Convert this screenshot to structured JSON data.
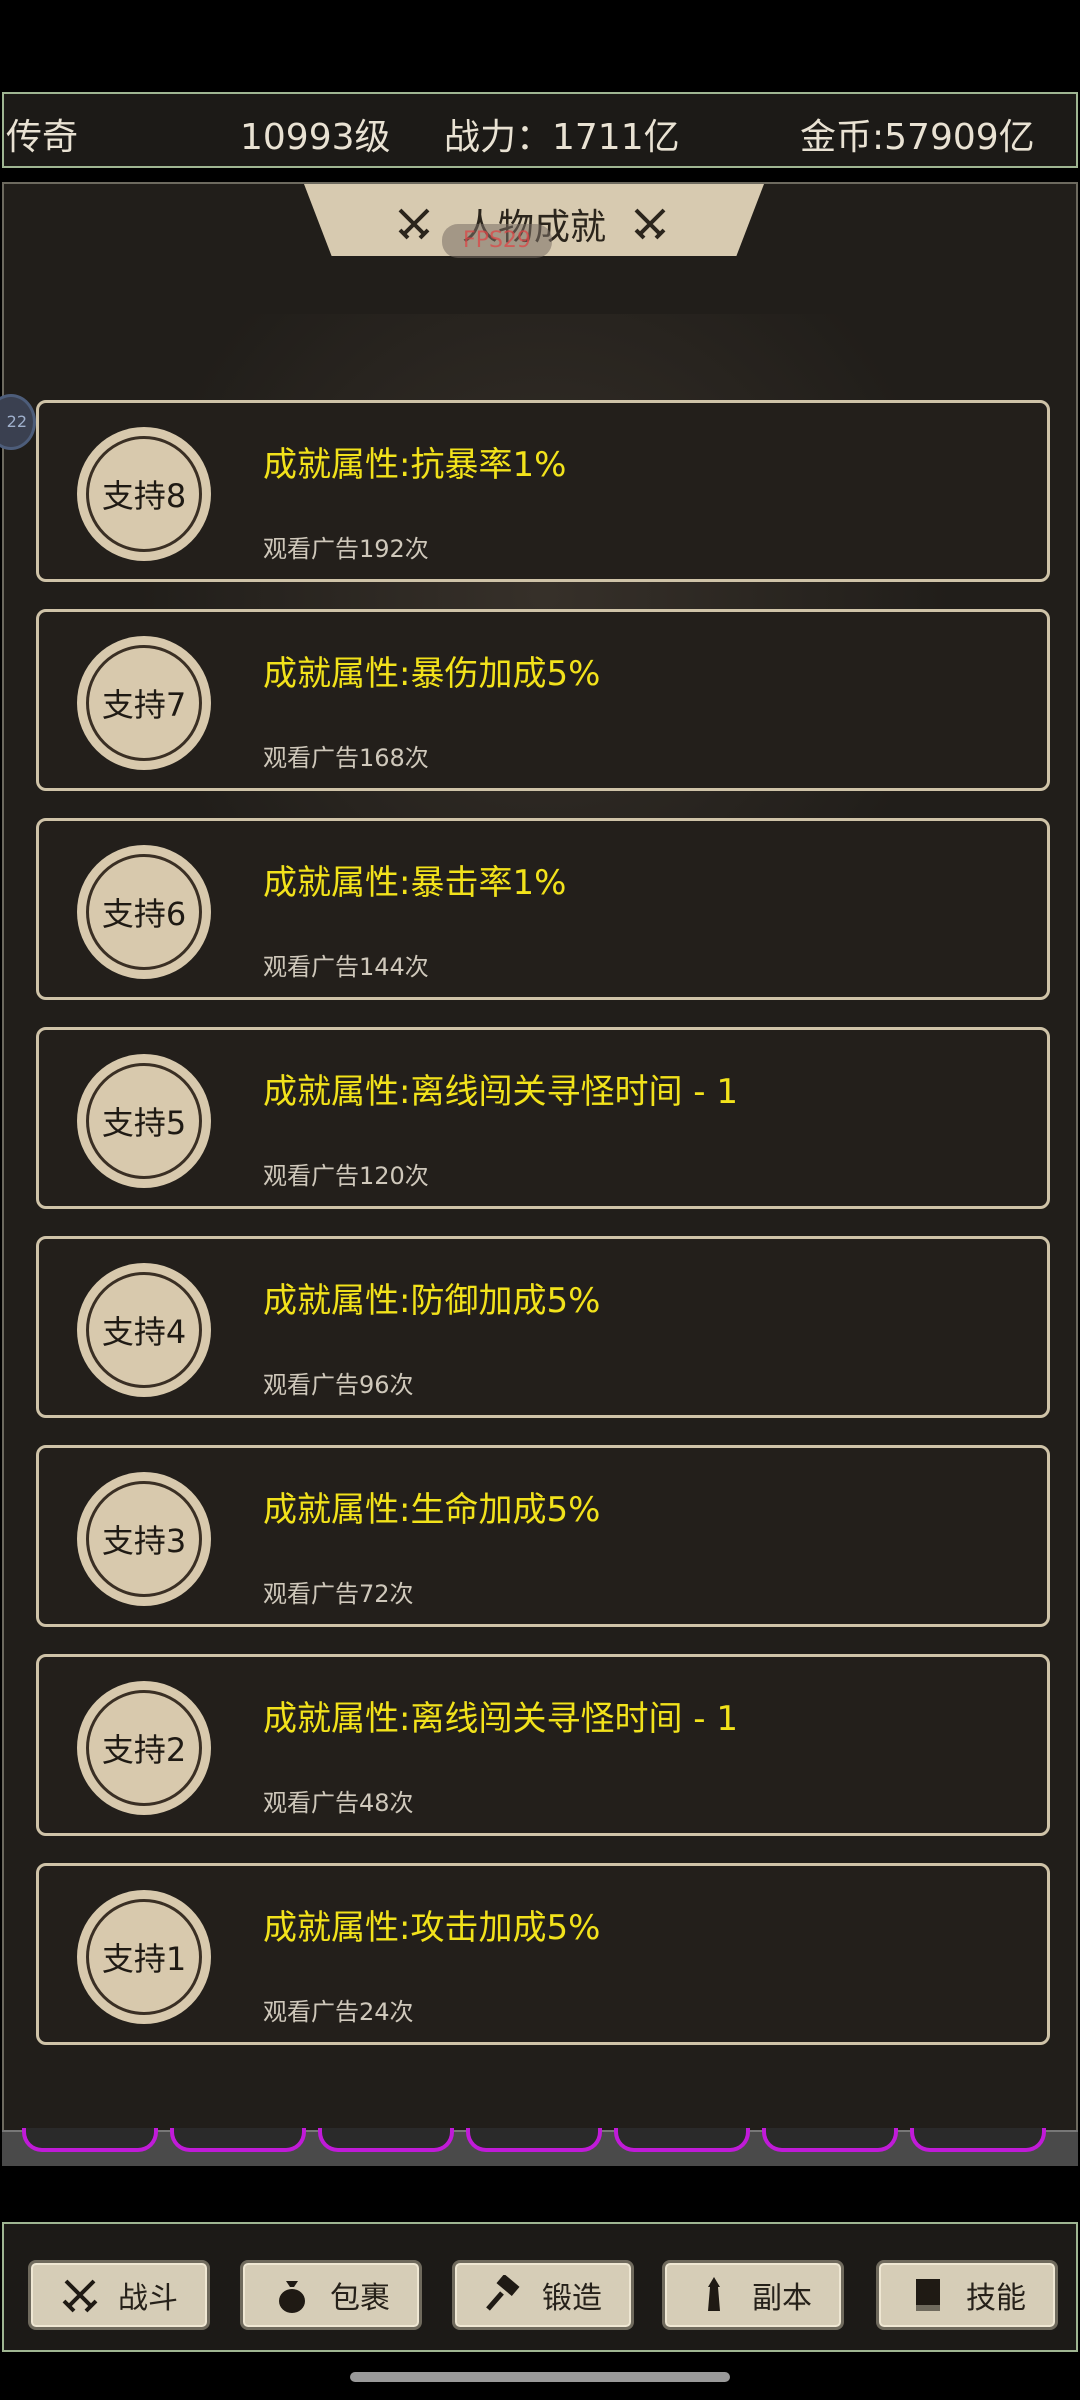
{
  "header": {
    "rank": "传奇",
    "level": "10993级",
    "power": "战力：1711亿",
    "gold": "金币:57909亿"
  },
  "panel": {
    "title": "人物成就",
    "fps": "FPS29",
    "side_bubble": "22"
  },
  "achievements": [
    {
      "badge": "支持8",
      "title": "成就属性:抗暴率1%",
      "subtitle": "观看广告192次"
    },
    {
      "badge": "支持7",
      "title": "成就属性:暴伤加成5%",
      "subtitle": "观看广告168次"
    },
    {
      "badge": "支持6",
      "title": "成就属性:暴击率1%",
      "subtitle": "观看广告144次"
    },
    {
      "badge": "支持5",
      "title": "成就属性:离线闯关寻怪时间 - 1",
      "subtitle": "观看广告120次"
    },
    {
      "badge": "支持4",
      "title": "成就属性:防御加成5%",
      "subtitle": "观看广告96次"
    },
    {
      "badge": "支持3",
      "title": "成就属性:生命加成5%",
      "subtitle": "观看广告72次"
    },
    {
      "badge": "支持2",
      "title": "成就属性:离线闯关寻怪时间 - 1",
      "subtitle": "观看广告48次"
    },
    {
      "badge": "支持1",
      "title": "成就属性:攻击加成5%",
      "subtitle": "观看广告24次"
    }
  ],
  "nav": [
    {
      "label": "战斗",
      "icon": "crossed-swords-icon"
    },
    {
      "label": "包裹",
      "icon": "bag-icon"
    },
    {
      "label": "锻造",
      "icon": "hammer-icon"
    },
    {
      "label": "副本",
      "icon": "tower-icon"
    },
    {
      "label": "技能",
      "icon": "book-icon"
    }
  ],
  "colors": {
    "accent_yellow": "#f2e21b",
    "card_border": "#cfc3a8",
    "panel_bg": "#211e1a",
    "badge_bg": "#d8c9ad",
    "tray_slot": "#c01bd8"
  }
}
